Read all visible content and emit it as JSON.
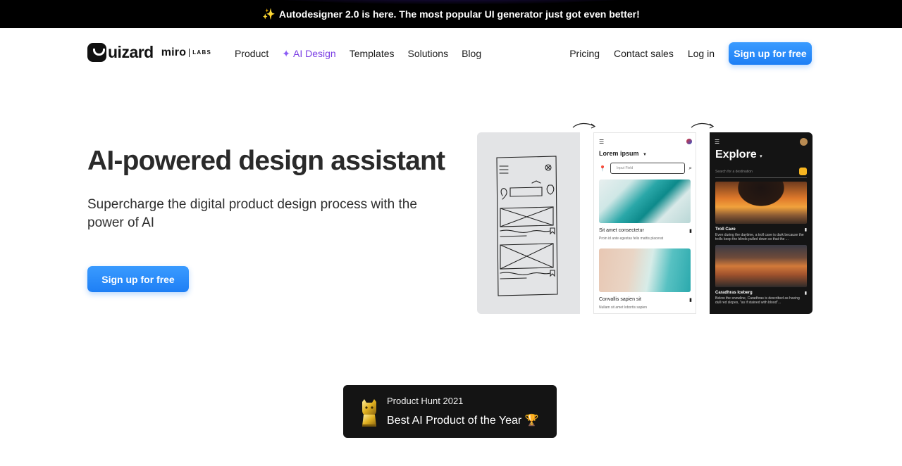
{
  "announcement": {
    "icon": "sparkles-icon",
    "text": "Autodesigner 2.0 is here. The most popular UI generator just got even better!"
  },
  "header": {
    "logo": "uizard",
    "partner": {
      "name": "miro",
      "labs": "LABS"
    },
    "nav_left": [
      "Product",
      "AI Design",
      "Templates",
      "Solutions",
      "Blog"
    ],
    "nav_right": [
      "Pricing",
      "Contact sales",
      "Log in"
    ],
    "cta": "Sign up for free",
    "colors": {
      "accent": "#1e7ff5",
      "ai_purple": "#7b3fe4"
    }
  },
  "hero": {
    "title": "AI-powered design assistant",
    "subtitle": "Supercharge the digital product design process with the power of AI",
    "cta": "Sign up for free"
  },
  "visual": {
    "light_mock": {
      "title": "Lorem ipsum",
      "input_placeholder": "Input Field",
      "card1_title": "Sit amet consectetur",
      "card1_desc": "Proin id ante egestas felis mattis placerat",
      "card2_title": "Convallis sapien sit",
      "card2_desc": "Nullam sit amet lobortis sapien"
    },
    "dark_mock": {
      "title": "Explore",
      "search_placeholder": "Search for a destination",
      "card1_title": "Troll Cave",
      "card1_desc": "Even during the daytime, a troll cave is dark because the trolls keep the blinds pulled down so that the ...",
      "card2_title": "Caradhras Iceberg",
      "card2_desc": "Below the snowline, Caradhras is described as having dull red slopes, \"as if stained with blood\"..."
    }
  },
  "badge": {
    "line1": "Product Hunt 2021",
    "line2": "Best AI Product of the Year 🏆"
  }
}
